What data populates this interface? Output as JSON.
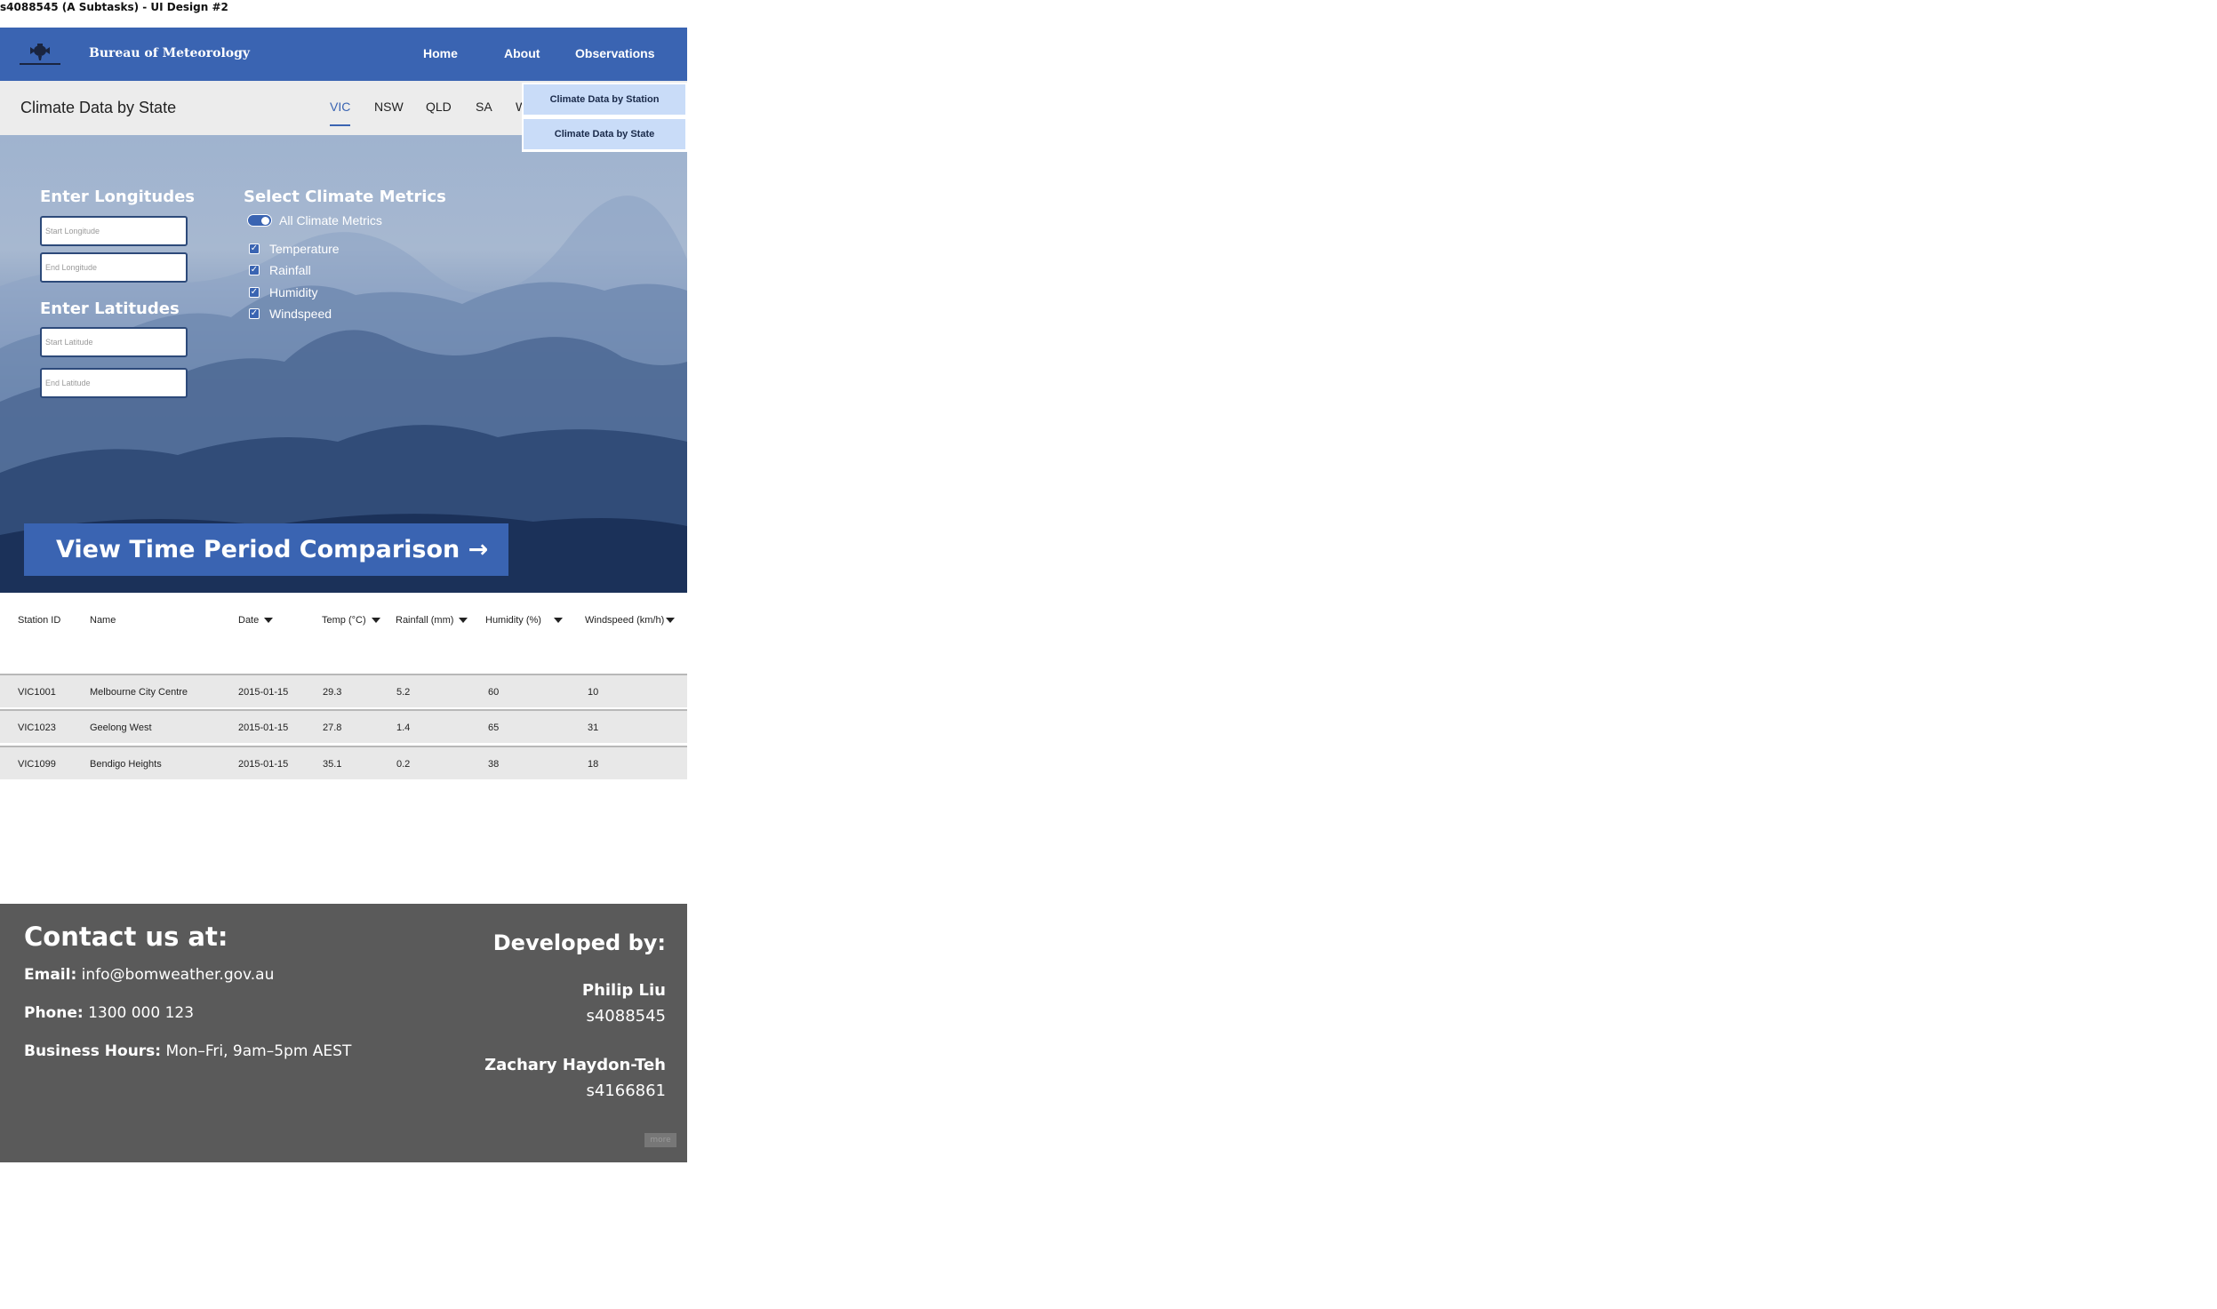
{
  "document": {
    "title": "s4088545 (A Subtasks) - UI Design #2"
  },
  "header": {
    "brand": "Bureau of Meteorology",
    "nav": {
      "home": "Home",
      "about": "About",
      "observations": "Observations"
    }
  },
  "dropdown": {
    "items": [
      "Climate Data by Station",
      "Climate Data by State"
    ]
  },
  "subheader": {
    "title": "Climate Data by State",
    "tabs": [
      "VIC",
      "NSW",
      "QLD",
      "SA",
      "W"
    ],
    "active_tab": "VIC"
  },
  "filters": {
    "longitudes": {
      "heading": "Enter Longitudes",
      "start_placeholder": "Start Longitude",
      "end_placeholder": "End Longitude"
    },
    "latitudes": {
      "heading": "Enter Latitudes",
      "start_placeholder": "Start Latitude",
      "end_placeholder": "End Latitude"
    },
    "metrics": {
      "heading": "Select Climate Metrics",
      "all_label": "All Climate Metrics",
      "all_enabled": true,
      "items": [
        {
          "label": "Temperature",
          "checked": true
        },
        {
          "label": "Rainfall",
          "checked": true
        },
        {
          "label": "Humidity",
          "checked": true
        },
        {
          "label": "Windspeed",
          "checked": true
        }
      ]
    },
    "cta_label": "View Time Period Comparison →"
  },
  "table": {
    "headers": [
      "Station ID",
      "Name",
      "Date",
      "Temp (°C)",
      "Rainfall (mm)",
      "Humidity (%)",
      "Windspeed (km/h)"
    ],
    "rows": [
      [
        "VIC1001",
        "Melbourne City Centre",
        "2015-01-15",
        "29.3",
        "5.2",
        "60",
        "10"
      ],
      [
        "VIC1023",
        "Geelong West",
        "2015-01-15",
        "27.8",
        "1.4",
        "65",
        "31"
      ],
      [
        "VIC1099",
        "Bendigo Heights",
        "2015-01-15",
        "35.1",
        "0.2",
        "38",
        "18"
      ]
    ]
  },
  "footer": {
    "contact_heading": "Contact us at:",
    "email_label": "Email:",
    "email": "info@bomweather.gov.au",
    "phone_label": "Phone:",
    "phone": "1300 000 123",
    "hours_label": "Business Hours:",
    "hours": "Mon–Fri, 9am–5pm AEST",
    "developed_heading": "Developed by:",
    "developers": [
      {
        "name": "Philip Liu",
        "id": "s4088545"
      },
      {
        "name": "Zachary Haydon-Teh",
        "id": "s4166861"
      }
    ],
    "more_label": "more"
  },
  "colors": {
    "primary": "#3a64b2",
    "subheader_bg": "#ececec",
    "row_bg": "#e8e8e8",
    "footer_bg": "#5a5a5a",
    "dropdown_item_bg": "#c9dcf8"
  }
}
